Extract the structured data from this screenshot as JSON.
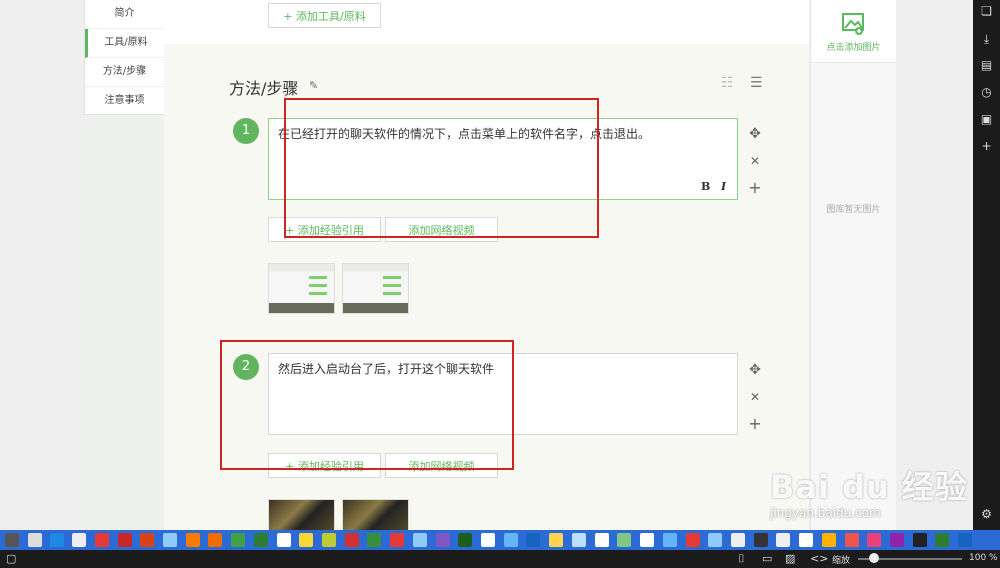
{
  "left_nav": {
    "items": [
      {
        "label": "简介"
      },
      {
        "label": "工具/原料"
      },
      {
        "label": "方法/步骤"
      },
      {
        "label": "注意事项"
      }
    ]
  },
  "tools": {
    "add_button": "+ 添加工具/原料"
  },
  "section": {
    "title": "方法/步骤"
  },
  "steps": [
    {
      "number": "1",
      "text": "在已经打开的聊天软件的情况下，点击菜单上的软件名字，点击退出。",
      "bold_label": "B",
      "italic_label": "I",
      "add_ref": "+ 添加经验引用",
      "add_video": "添加网络视频"
    },
    {
      "number": "2",
      "text": "然后进入启动台了后，打开这个聊天软件",
      "add_ref": "+ 添加经验引用",
      "add_video": "添加网络视频"
    }
  ],
  "controls": {
    "move": "✥",
    "delete": "✕",
    "add": "+"
  },
  "right_panel": {
    "add_image_label": "点击添加图片",
    "empty_label": "图库暂无图片"
  },
  "watermark": {
    "brand": "Bai du 经验",
    "url": "jingyan.baidu.com"
  },
  "status": {
    "zoom_label": "缩放",
    "zoom_value": "100 %",
    "zoom_fraction": 0.15
  },
  "colors": {
    "accent": "#62b55f",
    "annotation_red": "#d32222",
    "taskbar": "#2c6bd6"
  }
}
